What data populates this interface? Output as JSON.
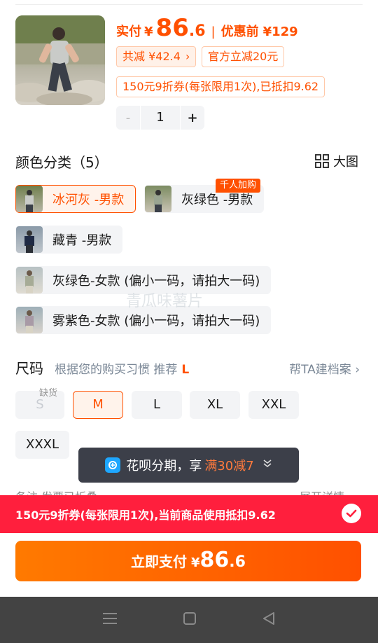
{
  "header": {
    "actual_label": "实付",
    "currency": "¥",
    "price_int": "86",
    "price_dec": ".6",
    "separator": "|",
    "before_label": "优惠前",
    "before_price": "¥129",
    "total_discount": "共减 ¥42.4",
    "official_discount": "官方立减20元",
    "coupon_note": "150元9折券(每张限用1次),已抵扣9.62"
  },
  "quantity": {
    "minus": "-",
    "value": "1",
    "plus": "+"
  },
  "color_section": {
    "title": "颜色分类（5）",
    "big_view": "大图",
    "hot_tag": "千人加购",
    "options": [
      {
        "label": "冰河灰 -男款",
        "selected": true
      },
      {
        "label": "灰绿色 -男款",
        "selected": false
      },
      {
        "label": "藏青 -男款",
        "selected": false
      },
      {
        "label": "灰绿色-女款 (偏小一码，请拍大一码)",
        "selected": false
      },
      {
        "label": "雾紫色-女款 (偏小一码，请拍大一码)",
        "selected": false
      }
    ]
  },
  "size_section": {
    "title": "尺码",
    "hint": "根据您的购买习惯 推荐",
    "recommended": "L",
    "archive_link": "帮TA建档案",
    "out_of_stock": "缺货",
    "sizes": [
      "S",
      "M",
      "L",
      "XL",
      "XXL",
      "XXXL"
    ],
    "selected": "M"
  },
  "toast": {
    "prefix": "花呗分期，享",
    "highlight": "满30减7"
  },
  "hidden_row": {
    "left": "备注 发票已折叠",
    "right": "展开详情"
  },
  "coupon_bar": {
    "text": "150元9折券(每张限用1次),当前商品使用抵扣9.62"
  },
  "pay_button": {
    "label": "立即支付",
    "currency": "¥",
    "int": "86",
    "dec": ".6"
  },
  "watermark": "青瓜味薯片",
  "colors": {
    "accent": "#ff5000",
    "coupon_red": "#ff1f3d",
    "toast_bg": "#3c3f49",
    "option_bg": "#f3f4f6"
  }
}
